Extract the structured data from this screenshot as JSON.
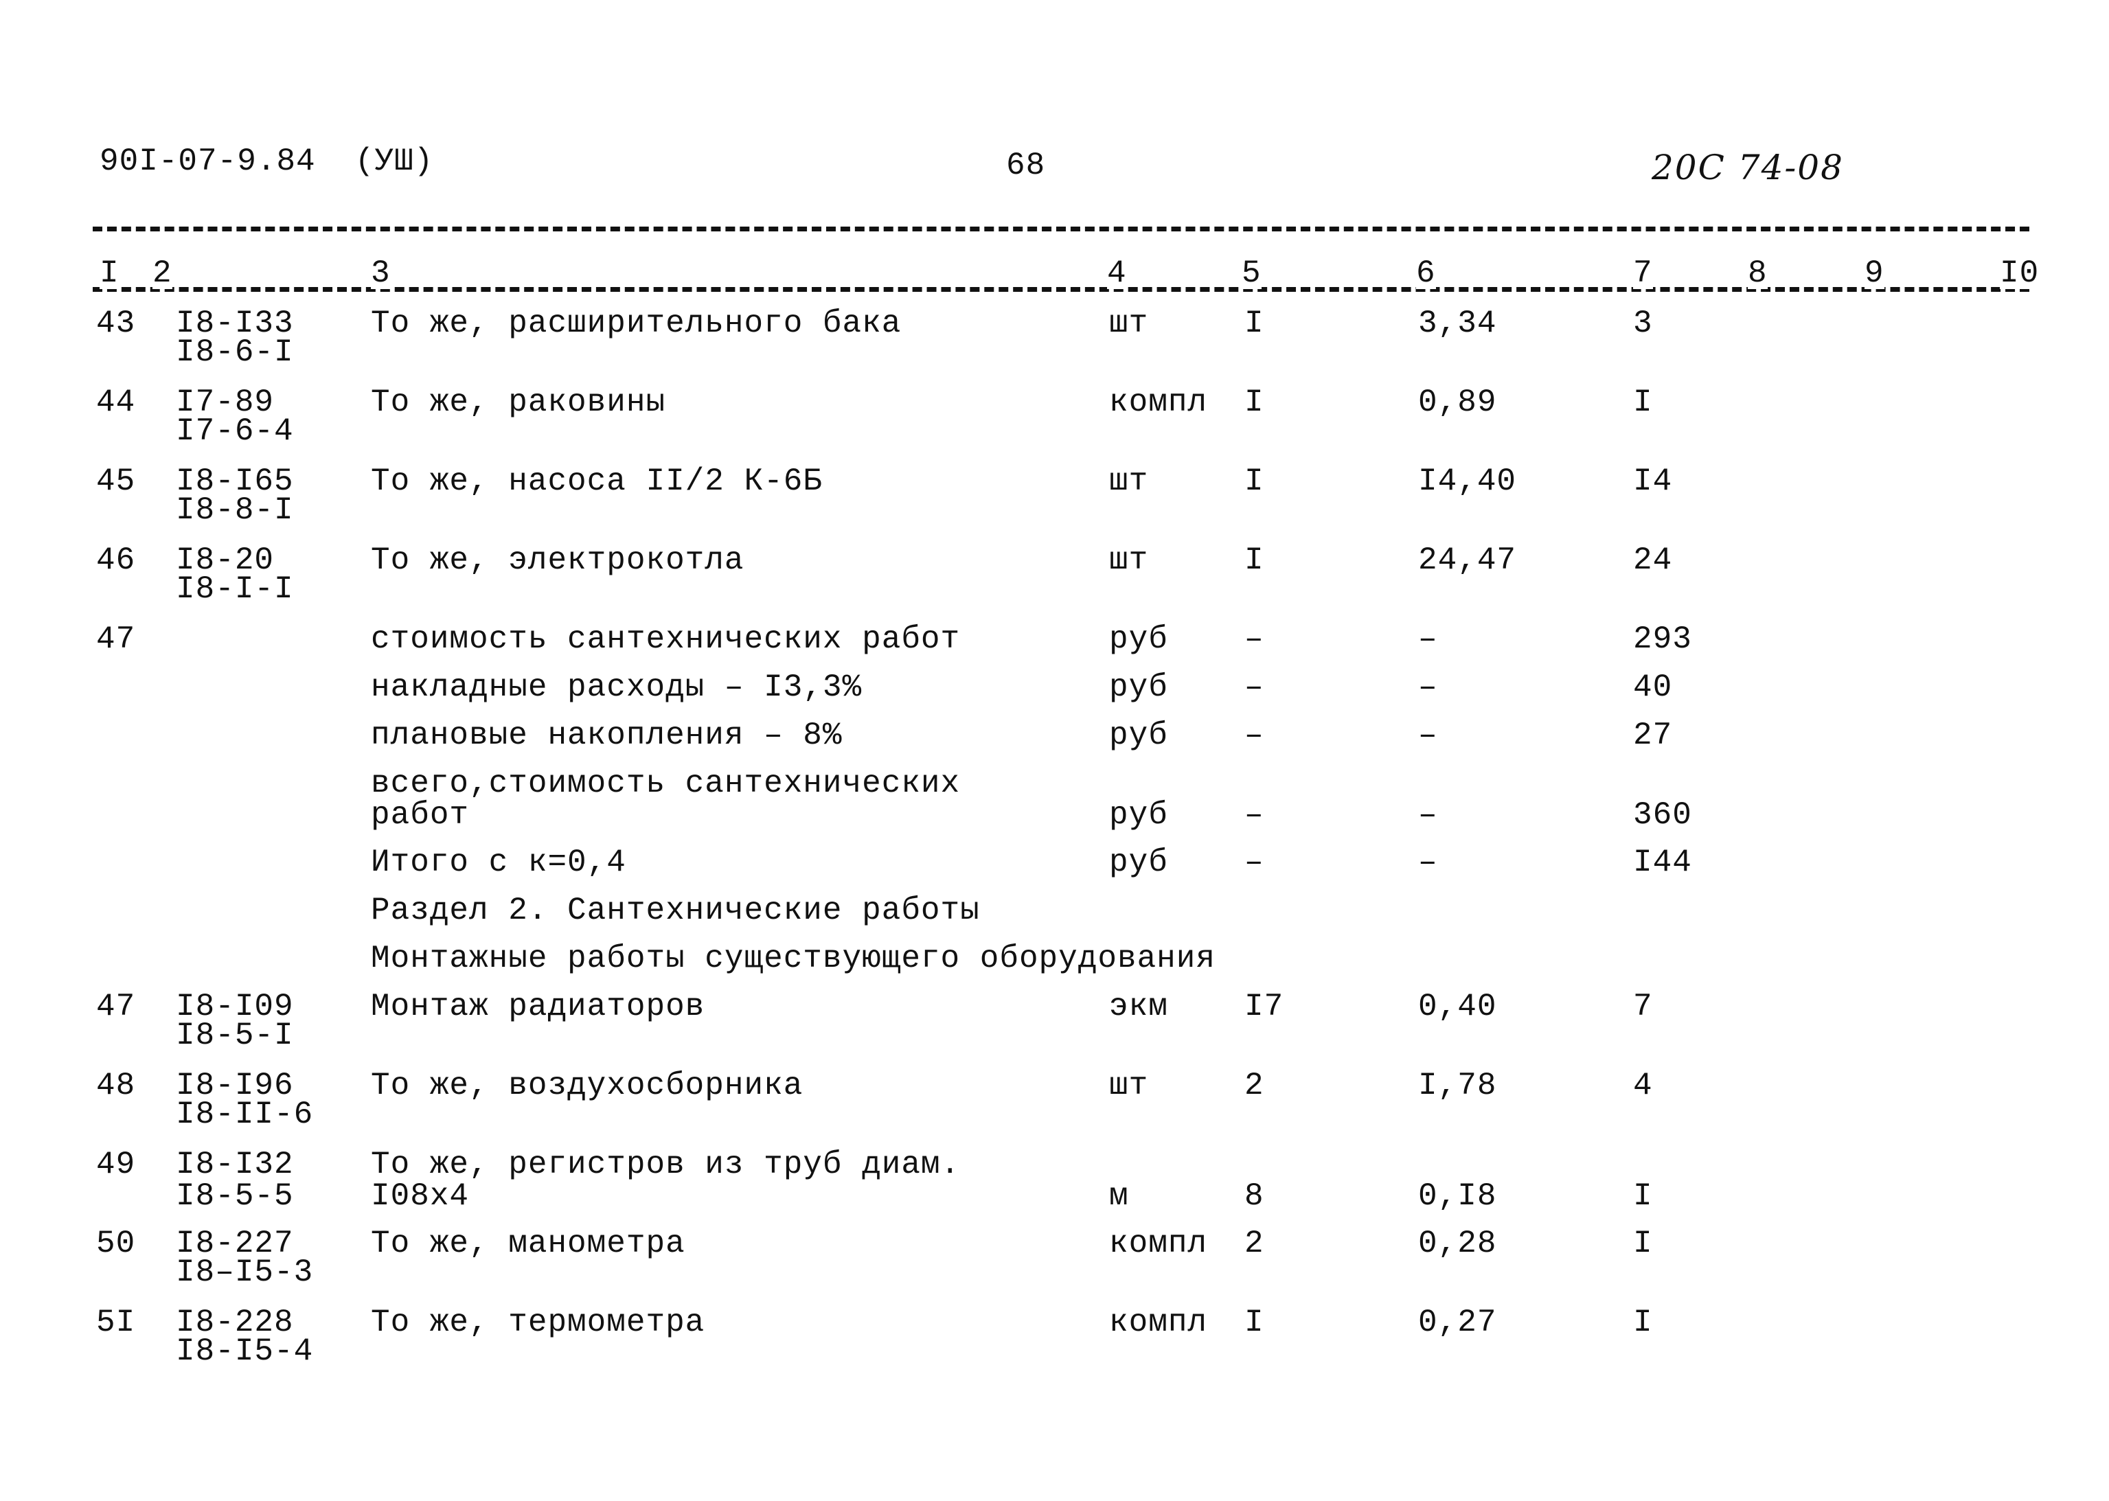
{
  "header": {
    "doc_code": "90I-07-9.84  (УШ)",
    "page_number": "68",
    "handwritten_note": "20С 74-08"
  },
  "column_numbers": [
    "I",
    "2",
    "3",
    "4",
    "5",
    "6",
    "7",
    "8",
    "9",
    "I0"
  ],
  "rows": [
    {
      "no": "43",
      "code1": "I8-I33",
      "code2": "I8-6-I",
      "desc1": "То же, расширительного бака",
      "desc2": "",
      "unit": "шт",
      "qty": "I",
      "price": "3,34",
      "total": "3"
    },
    {
      "no": "44",
      "code1": "I7-89",
      "code2": "I7-6-4",
      "desc1": "То же, раковины",
      "desc2": "",
      "unit": "компл",
      "qty": "I",
      "price": "0,89",
      "total": "I"
    },
    {
      "no": "45",
      "code1": "I8-I65",
      "code2": "I8-8-I",
      "desc1": "То же, насоса II/2 К-6Б",
      "desc2": "",
      "unit": "шт",
      "qty": "I",
      "price": "I4,40",
      "total": "I4"
    },
    {
      "no": "46",
      "code1": "I8-20",
      "code2": "I8-I-I",
      "desc1": "То же, электрокотла",
      "desc2": "",
      "unit": "шт",
      "qty": "I",
      "price": "24,47",
      "total": "24"
    }
  ],
  "summary": {
    "no": "47",
    "lines": [
      {
        "desc1": "стоимость сантехнических работ",
        "desc2": "",
        "unit": "руб",
        "qty": "–",
        "price": "–",
        "total": "293"
      },
      {
        "desc1": "накладные расходы – I3,3%",
        "desc2": "",
        "unit": "руб",
        "qty": "–",
        "price": "–",
        "total": "40"
      },
      {
        "desc1": "плановые накопления – 8%",
        "desc2": "",
        "unit": "руб",
        "qty": "–",
        "price": "–",
        "total": "27"
      },
      {
        "desc1": "всего,стоимость сантехнических",
        "desc2": "работ",
        "unit": "руб",
        "qty": "–",
        "price": "–",
        "total": "360"
      },
      {
        "desc1": "Итого с к=0,4",
        "desc2": "",
        "unit": "руб",
        "qty": "–",
        "price": "–",
        "total": "I44"
      }
    ]
  },
  "section": {
    "title": "Раздел 2. Сантехнические работы",
    "subtitle": "Монтажные работы существующего оборудования"
  },
  "rows2": [
    {
      "no": "47",
      "code1": "I8-I09",
      "code2": "I8-5-I",
      "desc1": "Монтаж радиаторов",
      "desc2": "",
      "unit": "экм",
      "qty": "I7",
      "price": "0,40",
      "total": "7"
    },
    {
      "no": "48",
      "code1": "I8-I96",
      "code2": "I8-II-6",
      "desc1": "То же, воздухосборника",
      "desc2": "",
      "unit": "шт",
      "qty": "2",
      "price": "I,78",
      "total": "4"
    },
    {
      "no": "49",
      "code1": "I8-I32",
      "code2": "I8-5-5",
      "desc1": "То же, регистров из труб диам.",
      "desc2": "I08х4",
      "unit": "м",
      "qty": "8",
      "price": "0,I8",
      "total": "I"
    },
    {
      "no": "50",
      "code1": "I8-227",
      "code2": "I8–I5-3",
      "desc1": "То же, манометра",
      "desc2": "",
      "unit": "компл",
      "qty": "2",
      "price": "0,28",
      "total": "I"
    },
    {
      "no": "5I",
      "code1": "I8-228",
      "code2": "I8-I5-4",
      "desc1": "То же, термометра",
      "desc2": "",
      "unit": "компл",
      "qty": "I",
      "price": "0,27",
      "total": "I"
    }
  ]
}
